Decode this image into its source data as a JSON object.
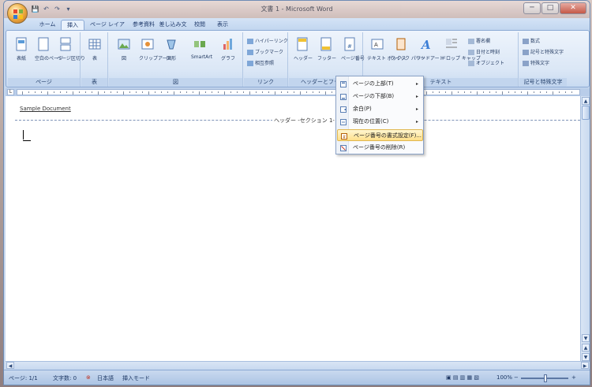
{
  "window": {
    "title": "文書 1 - Microsoft Word"
  },
  "quick_access": [
    "💾",
    "↶",
    "↷",
    "▾"
  ],
  "window_controls": {
    "minimize": "─",
    "maximize": "□",
    "close": "✕"
  },
  "ribbon_tabs": [
    {
      "label": "ホーム",
      "active": false
    },
    {
      "label": "挿入",
      "active": true
    },
    {
      "label": "ページ レイアウト",
      "active": false
    },
    {
      "label": "参考資料",
      "active": false
    },
    {
      "label": "差し込み文書",
      "active": false
    },
    {
      "label": "校閲",
      "active": false
    },
    {
      "label": "表示",
      "active": false
    }
  ],
  "ribbon_groups": {
    "pages": {
      "label": "ページ",
      "buttons": [
        "表紙",
        "空白のページ",
        "ページ区切り"
      ]
    },
    "tables": {
      "label": "表",
      "buttons": [
        "表"
      ]
    },
    "illustrations": {
      "label": "図",
      "buttons": [
        "図",
        "クリップアート",
        "図形",
        "SmartArt",
        "グラフ"
      ]
    },
    "links": {
      "label": "リンク",
      "items": [
        "ハイパーリンク",
        "ブックマーク",
        "相互参照"
      ]
    },
    "header_footer": {
      "label": "ヘッダーとフッター",
      "buttons": [
        "ヘッダー",
        "フッター",
        "ページ番号"
      ]
    },
    "text": {
      "label": "テキスト",
      "buttons": [
        "テキスト ボックス",
        "クイック パーツ",
        "ワードアート",
        "ドロップ キャップ"
      ],
      "items": [
        "署名欄",
        "日付と時刻",
        "オブジェクト"
      ]
    },
    "symbols": {
      "label": "記号と特殊文字",
      "items": [
        "数式",
        "記号と特殊文字",
        "特殊文字"
      ]
    }
  },
  "page_number_menu": {
    "items": [
      {
        "label": "ページの上部(T)",
        "has_submenu": true,
        "highlighted": false
      },
      {
        "label": "ページの下部(B)",
        "has_submenu": true,
        "highlighted": false
      },
      {
        "label": "余白(P)",
        "has_submenu": true,
        "highlighted": false
      },
      {
        "label": "現在の位置(C)",
        "has_submenu": true,
        "highlighted": false
      },
      {
        "label": "ページ番号の書式設定(F)...",
        "has_submenu": false,
        "highlighted": true
      },
      {
        "label": "ページ番号の削除(R)",
        "has_submenu": false,
        "highlighted": false
      }
    ]
  },
  "document": {
    "top_label": "Sample Document",
    "header_tag": "ヘッダー -セクション 1-"
  },
  "status_bar": {
    "page": "ページ: 1/1",
    "words": "文字数: 0",
    "language": "日本語",
    "mode": "挿入モード",
    "zoom": "100%"
  },
  "colors": {
    "ribbon_bg": "#dbe7f6",
    "menu_highlight": "#ffe08a",
    "accent": "#1f3a6b"
  }
}
